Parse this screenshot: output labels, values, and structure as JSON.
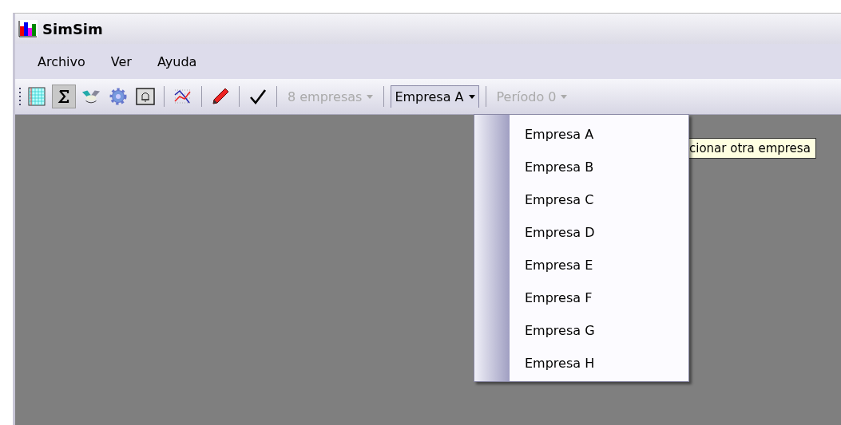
{
  "window": {
    "title": "SimSim"
  },
  "menu": [
    "Archivo",
    "Ver",
    "Ayuda"
  ],
  "toolbar": [
    {
      "kind": "grid",
      "pressed": false
    },
    {
      "kind": "sigma",
      "pressed": true
    },
    {
      "kind": "handshake",
      "pressed": false
    },
    {
      "kind": "gear",
      "pressed": false
    },
    {
      "kind": "bell",
      "pressed": false
    },
    {
      "kind": "sep"
    },
    {
      "kind": "chart",
      "pressed": false
    },
    {
      "kind": "sep"
    },
    {
      "kind": "pencil",
      "pressed": false
    },
    {
      "kind": "sep"
    },
    {
      "kind": "check",
      "pressed": false
    },
    {
      "kind": "sep"
    }
  ],
  "combos": [
    {
      "label": "8 empresas",
      "disabled": true,
      "expanded": false
    },
    {
      "label": "Empresa A",
      "disabled": false,
      "expanded": true
    },
    {
      "label": "Período 0",
      "disabled": true,
      "expanded": false
    }
  ],
  "dropdown": {
    "items": [
      {
        "label": "Empresa A",
        "selected": false
      },
      {
        "label": "Empresa B",
        "selected": false
      },
      {
        "label": "Empresa C",
        "selected": false
      },
      {
        "label": "Empresa D",
        "selected": false
      },
      {
        "label": "Empresa E",
        "selected": false
      },
      {
        "label": "Empresa F",
        "selected": false
      },
      {
        "label": "Empresa G",
        "selected": false
      },
      {
        "label": "Empresa H",
        "selected": false
      }
    ]
  },
  "tooltip": "cionar otra empresa"
}
